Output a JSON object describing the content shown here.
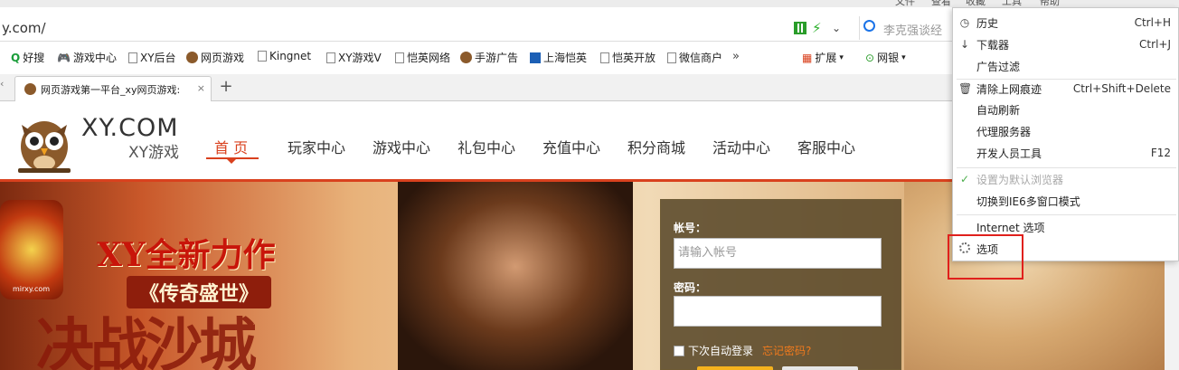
{
  "browser": {
    "top_menu": [
      "文件",
      "查看",
      "收藏",
      "工具",
      "帮助"
    ],
    "url": "y.com/",
    "search_placeholder": "李克强谈经",
    "bookmarks": [
      "好搜",
      "游戏中心",
      "XY后台",
      "网页游戏",
      "Kingnet",
      "XY游戏V",
      "恺英网络",
      "手游广告",
      "上海恺英",
      "恺英开放",
      "微信商户"
    ],
    "bookmarks_more": "»",
    "extensions": {
      "expand": "扩展",
      "bank": "网银"
    },
    "tab_title": "网页游戏第一平台_xy网页游戏:",
    "new_tab": "+"
  },
  "site": {
    "logo_main": "XY.COM",
    "logo_sub": "XY游戏",
    "nav": [
      "首 页",
      "玩家中心",
      "游戏中心",
      "礼包中心",
      "充值中心",
      "积分商城",
      "活动中心",
      "客服中心"
    ],
    "banner": {
      "slogan": "XY全新力作",
      "subtitle": "《传奇盛世》",
      "logo_text": "mirxy.com",
      "calligraphy": "决战沙城"
    },
    "login": {
      "account_label": "帐号：",
      "account_placeholder": "请输入帐号",
      "password_label": "密码：",
      "remember_label": "下次自动登录",
      "forgot_label": "忘记密码?"
    }
  },
  "tools_menu": {
    "items": [
      {
        "label": "历史",
        "shortcut": "Ctrl+H",
        "icon": "clock-icon"
      },
      {
        "label": "下载器",
        "shortcut": "Ctrl+J",
        "icon": "download-arrow-icon"
      },
      {
        "label": "广告过滤",
        "shortcut": "",
        "icon": ""
      },
      {
        "label": "清除上网痕迹",
        "shortcut": "Ctrl+Shift+Delete",
        "icon": "trash-icon"
      },
      {
        "label": "自动刷新",
        "shortcut": "",
        "icon": ""
      },
      {
        "label": "代理服务器",
        "shortcut": "",
        "icon": ""
      },
      {
        "label": "开发人员工具",
        "shortcut": "F12",
        "icon": ""
      },
      {
        "label": "设置为默认浏览器",
        "shortcut": "",
        "icon": "check-icon",
        "disabled": true
      },
      {
        "label": "切换到IE6多窗口模式",
        "shortcut": "",
        "icon": ""
      },
      {
        "label": "Internet 选项",
        "shortcut": "",
        "icon": ""
      },
      {
        "label": "选项",
        "shortcut": "",
        "icon": "gear-icon",
        "highlighted": true
      }
    ]
  },
  "colors": {
    "accent": "#d9411e",
    "highlight": "#e0201c",
    "check": "#4cae4c"
  }
}
